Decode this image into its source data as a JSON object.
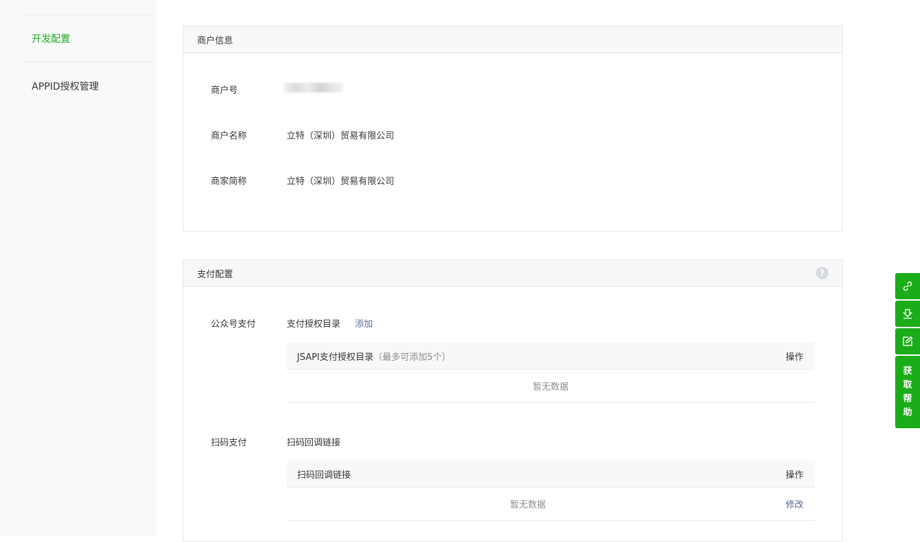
{
  "sidebar": {
    "items": [
      {
        "label": "开发配置",
        "active": true
      },
      {
        "label": "APPID授权管理",
        "active": false
      }
    ]
  },
  "merchant_info": {
    "title": "商户信息",
    "rows": [
      {
        "label": "商户号",
        "value": ""
      },
      {
        "label": "商户名称",
        "value": "立特（深圳）贸易有限公司"
      },
      {
        "label": "商家简称",
        "value": "立特（深圳）贸易有限公司"
      }
    ]
  },
  "payment_config": {
    "title": "支付配置",
    "help_glyph": "?",
    "official_account": {
      "label": "公众号支付",
      "dir_label": "支付授权目录",
      "add_link": "添加",
      "table": {
        "header": "JSAPI支付授权目录",
        "header_note": "（最多可添加5个）",
        "action_header": "操作",
        "empty_text": "暂无数据"
      }
    },
    "scan_pay": {
      "label": "扫码支付",
      "callback_label": "扫码回调链接",
      "table": {
        "header": "扫码回调链接",
        "action_header": "操作",
        "empty_text": "暂无数据",
        "edit_link": "修改"
      }
    }
  },
  "float_bar": {
    "icons": [
      "link-icon",
      "download-icon",
      "edit-icon"
    ],
    "help_chars": [
      "获",
      "取",
      "帮",
      "助"
    ],
    "color": "#1aad19"
  }
}
